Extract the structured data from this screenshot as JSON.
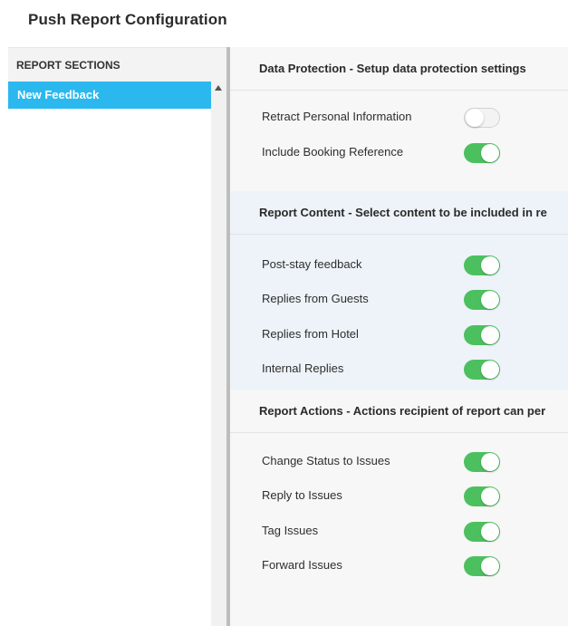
{
  "page": {
    "title": "Push Report Configuration"
  },
  "sidebar": {
    "header": "REPORT SECTIONS",
    "items": [
      {
        "label": "New Feedback",
        "selected": true
      }
    ]
  },
  "colors": {
    "accent": "#2bb8ef",
    "toggle_on": "#4cc05f",
    "toggle_off": "#f3f3f3"
  },
  "sections": [
    {
      "title": "Data Protection - Setup data protection settings",
      "rows": [
        {
          "label": "Retract Personal Information",
          "enabled": false
        },
        {
          "label": "Include Booking Reference",
          "enabled": true
        }
      ]
    },
    {
      "title": "Report Content - Select content to be included in re",
      "rows": [
        {
          "label": "Post-stay feedback",
          "enabled": true
        },
        {
          "label": "Replies from Guests",
          "enabled": true
        },
        {
          "label": "Replies from Hotel",
          "enabled": true
        },
        {
          "label": "Internal Replies",
          "enabled": true
        }
      ]
    },
    {
      "title": "Report Actions - Actions recipient of report can per",
      "rows": [
        {
          "label": "Change Status to Issues",
          "enabled": true
        },
        {
          "label": "Reply to Issues",
          "enabled": true
        },
        {
          "label": "Tag Issues",
          "enabled": true
        },
        {
          "label": "Forward Issues",
          "enabled": true
        }
      ]
    }
  ]
}
